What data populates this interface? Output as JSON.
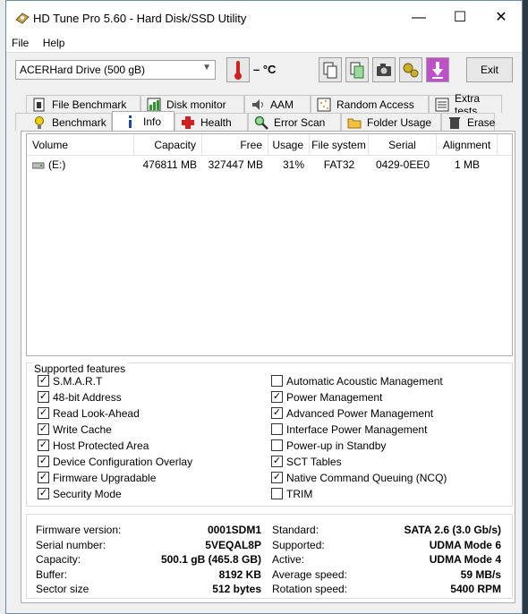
{
  "window": {
    "title": "HD Tune Pro 5.60 - Hard Disk/SSD Utility",
    "minimize": "—",
    "maximize": "☐",
    "close": "✕"
  },
  "menu": {
    "file": "File",
    "help": "Help"
  },
  "toolbar": {
    "drive": "ACERHard Drive (500 gB)",
    "temperature": "– °C",
    "exit": "Exit"
  },
  "tabs_row1": [
    "File Benchmark",
    "Disk monitor",
    "AAM",
    "Random Access",
    "Extra tests"
  ],
  "tabs_row2": [
    "Benchmark",
    "Info",
    "Health",
    "Error Scan",
    "Folder Usage",
    "Erase"
  ],
  "volume_table": {
    "headers": [
      "Volume",
      "Capacity",
      "Free",
      "Usage",
      "File system",
      "Serial",
      "Alignment"
    ],
    "rows": [
      {
        "volume": "(E:)",
        "capacity": "476811 MB",
        "free": "327447 MB",
        "usage": "31%",
        "fs": "FAT32",
        "serial": "0429-0EE0",
        "alignment": "1 MB"
      }
    ]
  },
  "features": {
    "title": "Supported features",
    "left": [
      {
        "label": "S.M.A.R.T",
        "checked": true
      },
      {
        "label": "48-bit Address",
        "checked": true
      },
      {
        "label": "Read Look-Ahead",
        "checked": true
      },
      {
        "label": "Write Cache",
        "checked": true
      },
      {
        "label": "Host Protected Area",
        "checked": true
      },
      {
        "label": "Device Configuration Overlay",
        "checked": true
      },
      {
        "label": "Firmware Upgradable",
        "checked": true
      },
      {
        "label": "Security Mode",
        "checked": true
      }
    ],
    "right": [
      {
        "label": "Automatic Acoustic Management",
        "checked": false
      },
      {
        "label": "Power Management",
        "checked": true
      },
      {
        "label": "Advanced Power Management",
        "checked": true
      },
      {
        "label": "Interface Power Management",
        "checked": false
      },
      {
        "label": "Power-up in Standby",
        "checked": false
      },
      {
        "label": "SCT Tables",
        "checked": true
      },
      {
        "label": "Native Command Queuing (NCQ)",
        "checked": true
      },
      {
        "label": "TRIM",
        "checked": false
      }
    ]
  },
  "info": {
    "left": [
      {
        "label": "Firmware version:",
        "value": "0001SDM1"
      },
      {
        "label": "Serial number:",
        "value": "5VEQAL8P"
      },
      {
        "label": "Capacity:",
        "value": "500.1 gB (465.8 GB)"
      },
      {
        "label": "Buffer:",
        "value": "8192 KB"
      },
      {
        "label": "Sector size",
        "value": "512 bytes"
      }
    ],
    "right": [
      {
        "label": "Standard:",
        "value": "SATA 2.6 (3.0 Gb/s)"
      },
      {
        "label": "Supported:",
        "value": "UDMA Mode 6"
      },
      {
        "label": "Active:",
        "value": "UDMA Mode 4"
      },
      {
        "label": "Average speed:",
        "value": "59 MB/s"
      },
      {
        "label": "Rotation speed:",
        "value": "5400 RPM"
      }
    ]
  }
}
